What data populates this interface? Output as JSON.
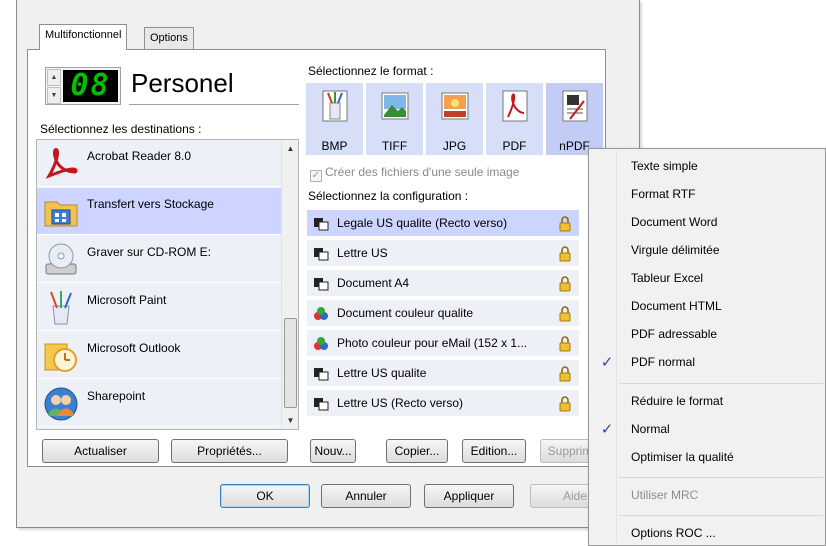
{
  "tabs": [
    {
      "label": "Multifonctionnel",
      "active": true
    },
    {
      "label": "Options",
      "active": false
    }
  ],
  "profile": {
    "counter": "08",
    "name": "Personel"
  },
  "destinations": {
    "label": "Sélectionnez les destinations :",
    "items": [
      {
        "label": "Acrobat Reader 8.0",
        "icon": "acrobat-icon"
      },
      {
        "label": "Transfert vers Stockage",
        "icon": "folder-storage-icon",
        "selected": true
      },
      {
        "label": "Graver sur CD-ROM  E:",
        "icon": "cd-drive-icon"
      },
      {
        "label": "Microsoft Paint",
        "icon": "paint-icon"
      },
      {
        "label": "Microsoft Outlook",
        "icon": "outlook-icon"
      },
      {
        "label": "Sharepoint",
        "icon": "sharepoint-icon"
      }
    ],
    "buttons": {
      "refresh": "Actualiser",
      "properties": "Propriétés..."
    }
  },
  "format": {
    "label": "Sélectionnez le format :",
    "items": [
      {
        "label": "BMP",
        "icon": "bmp-icon"
      },
      {
        "label": "TIFF",
        "icon": "tiff-icon"
      },
      {
        "label": "JPG",
        "icon": "jpg-icon"
      },
      {
        "label": "PDF",
        "icon": "pdf-icon"
      },
      {
        "label": "nPDF",
        "icon": "npdf-icon",
        "selected": true
      }
    ],
    "single_image_label": "Créer des fichiers d'une seule image"
  },
  "configuration": {
    "label": "Sélectionnez la configuration :",
    "items": [
      {
        "label": "Legale US qualite (Recto verso)",
        "icon": "bw-scan-icon",
        "selected": true
      },
      {
        "label": "Lettre US",
        "icon": "bw-scan-icon"
      },
      {
        "label": "Document A4",
        "icon": "bw-scan-icon"
      },
      {
        "label": "Document couleur qualite",
        "icon": "color-scan-icon"
      },
      {
        "label": "Photo couleur pour eMail (152 x 1...",
        "icon": "color-scan-icon"
      },
      {
        "label": "Lettre US qualite",
        "icon": "bw-scan-icon"
      },
      {
        "label": "Lettre US (Recto verso)",
        "icon": "bw-scan-icon"
      }
    ],
    "buttons": {
      "new": "Nouv...",
      "copy": "Copier...",
      "edit": "Edition...",
      "delete": "Supprim"
    }
  },
  "footer": {
    "ok": "OK",
    "cancel": "Annuler",
    "apply": "Appliquer",
    "help": "Aide"
  },
  "context_menu": {
    "items": [
      {
        "label": "Texte simple"
      },
      {
        "label": "Format RTF"
      },
      {
        "label": "Document Word"
      },
      {
        "label": "Virgule délimitée"
      },
      {
        "label": "Tableur Excel"
      },
      {
        "label": "Document HTML"
      },
      {
        "label": "PDF adressable"
      },
      {
        "label": "PDF normal",
        "checked": true
      },
      {
        "label": "Réduire le format"
      },
      {
        "label": "Normal",
        "checked": true
      },
      {
        "label": "Optimiser la qualité"
      },
      {
        "label": "Utiliser MRC",
        "disabled": true
      },
      {
        "label": "Options ROC ..."
      }
    ]
  },
  "colors": {
    "selection": "#ccd4ff",
    "list_bg": "#eef0f8",
    "lcd_text": "#00c000",
    "check": "#1e50a0"
  }
}
